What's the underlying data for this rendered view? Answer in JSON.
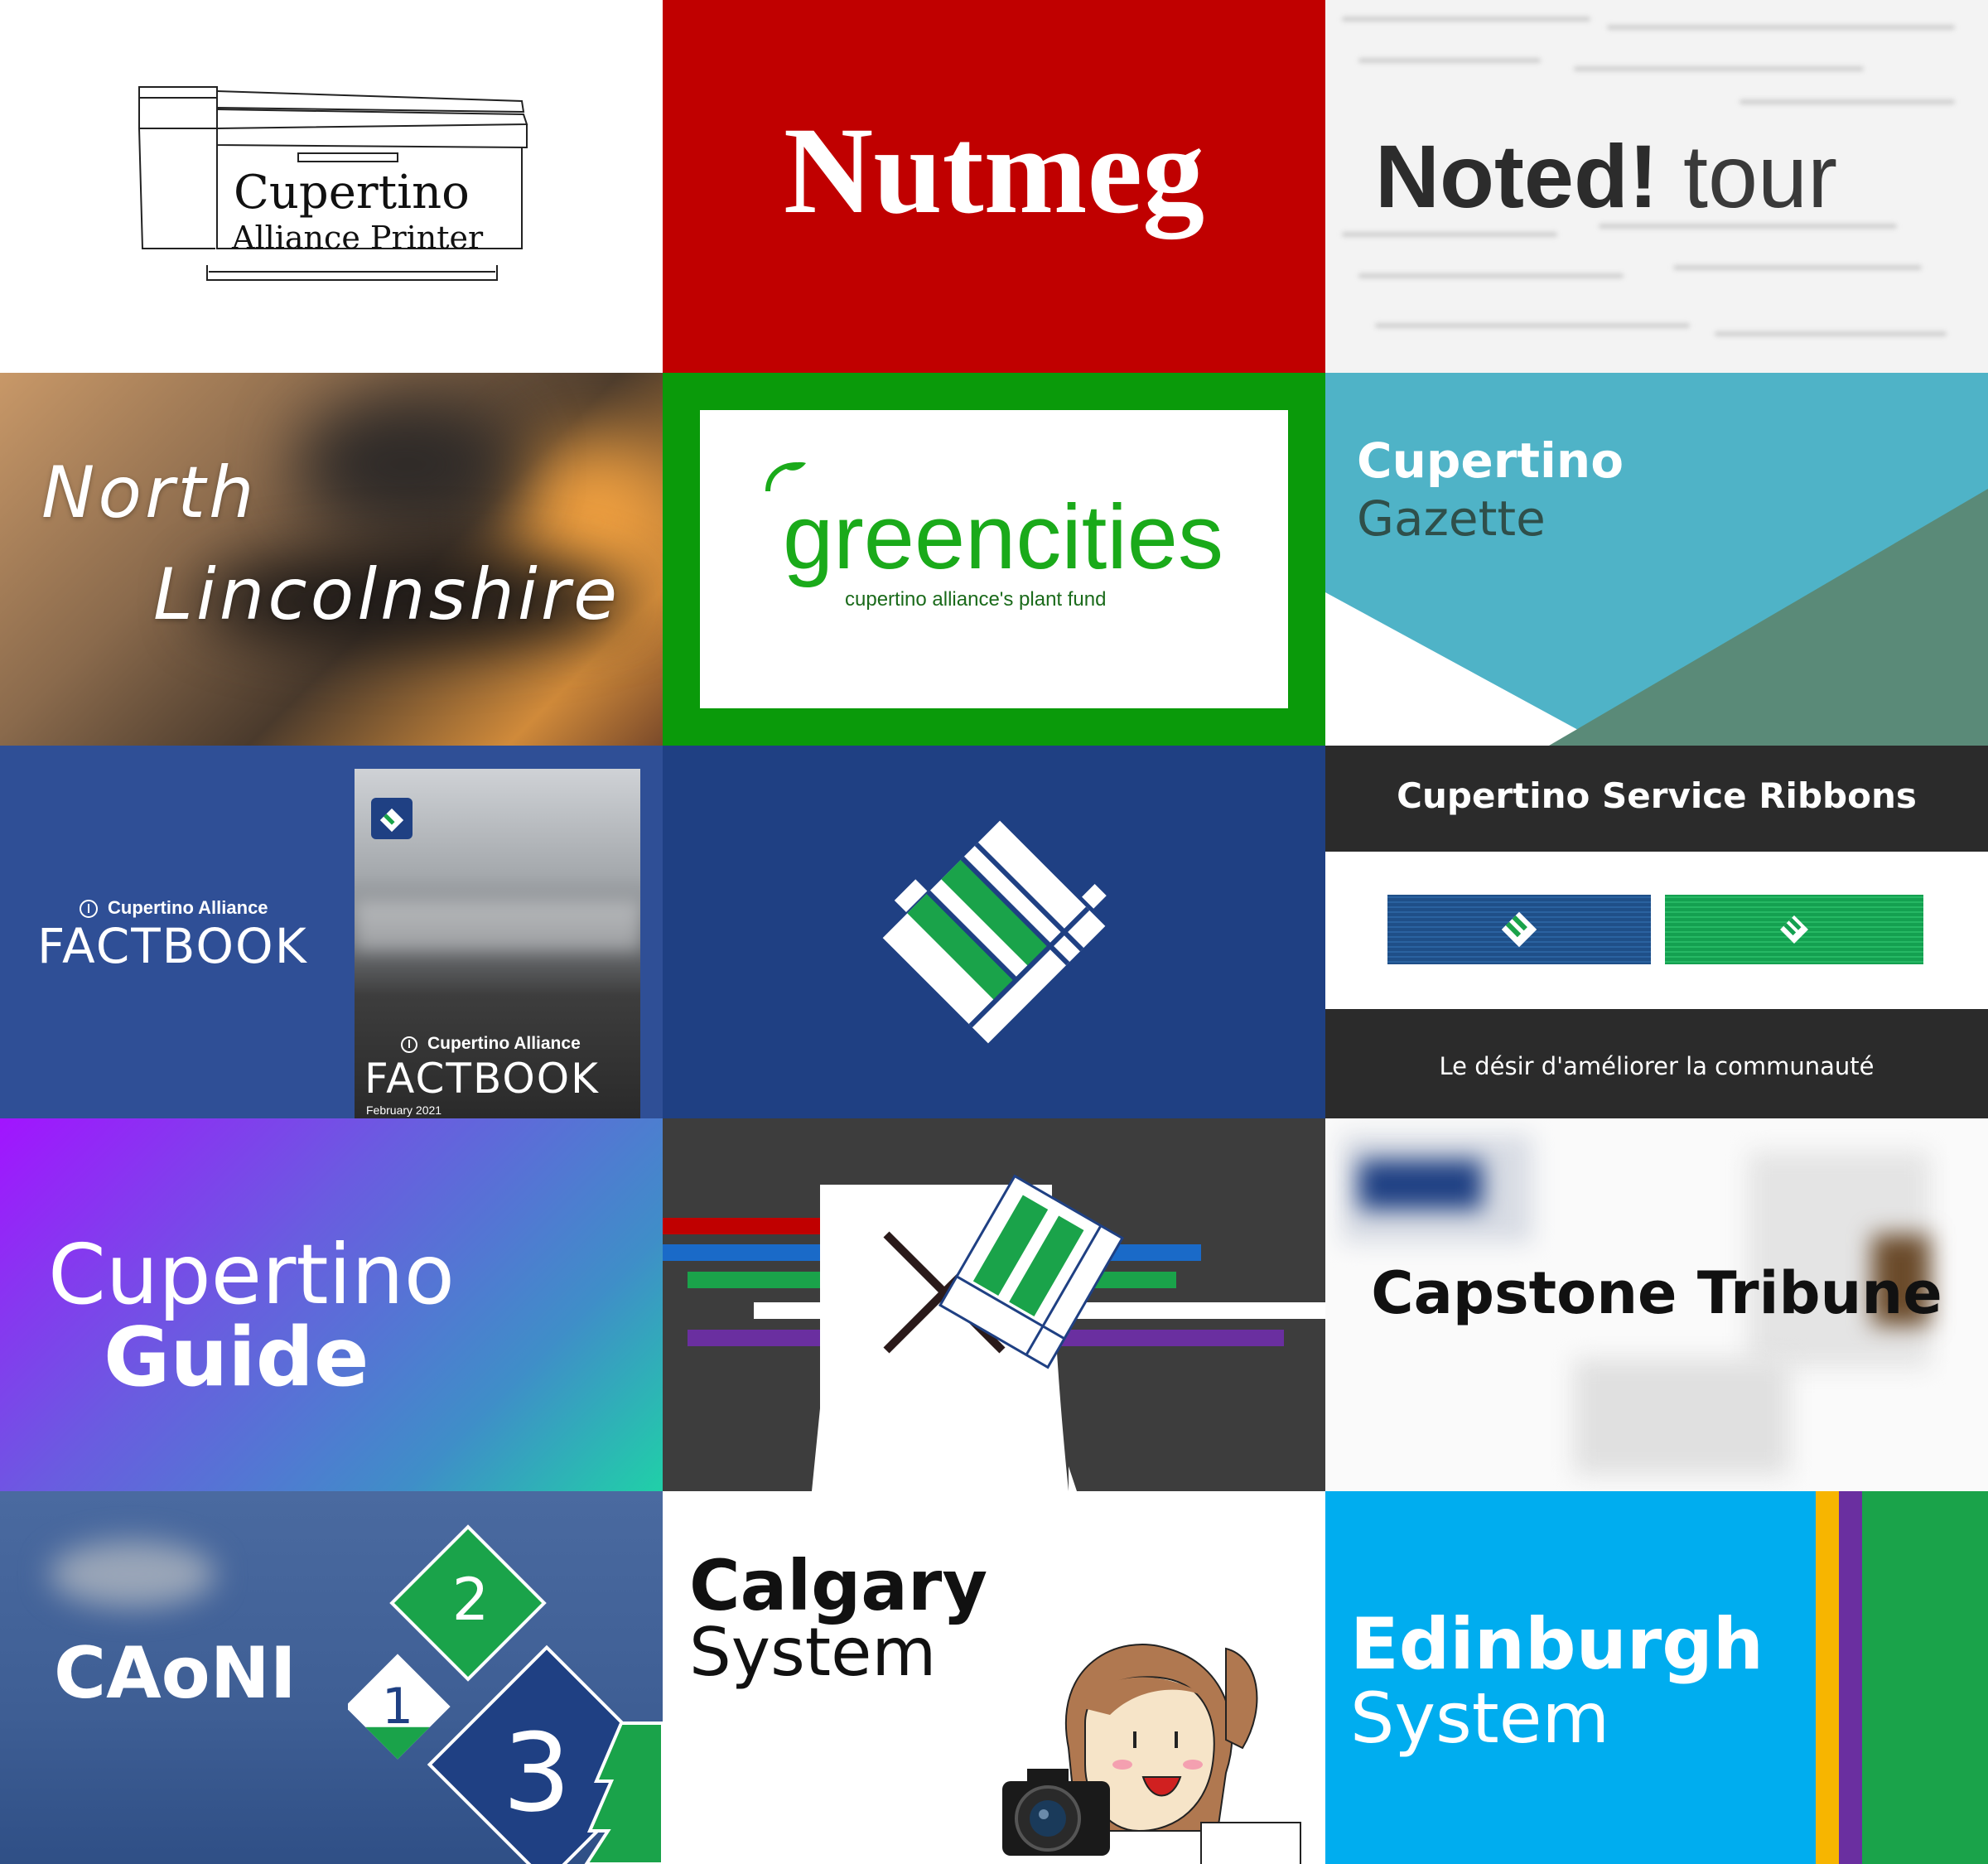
{
  "tiles": {
    "printer": {
      "line1": "Cupertino",
      "line2": "Alliance Printer"
    },
    "nutmeg": {
      "title": "Nutmeg",
      "bg": "#c00000"
    },
    "noted": {
      "bold": "Noted!",
      "light": "tour"
    },
    "north": {
      "line1": "North",
      "line2": "Lincolnshire"
    },
    "greencities": {
      "word": "greencities",
      "sub": "cupertino alliance's plant fund",
      "accent": "#0a9a0a"
    },
    "gazette": {
      "line1": "Cupertino",
      "line2": "Gazette"
    },
    "factbook": {
      "org": "Cupertino Alliance",
      "title": "FACTBOOK",
      "cover_org": "Cupertino Alliance",
      "cover_title": "FACTBOOK",
      "cover_date": "February 2021"
    },
    "ribbons": {
      "title": "Cupertino Service Ribbons",
      "motto": "Le désir d'améliorer la communauté"
    },
    "guide": {
      "line1": "Cupertino",
      "line2": "Guide"
    },
    "capstone": {
      "title": "Capstone Tribune"
    },
    "caoni": {
      "title": "CAoNI",
      "num1": "1",
      "num2": "2",
      "num3": "3"
    },
    "calgary": {
      "line1": "Calgary",
      "line2": "System"
    },
    "edinburgh": {
      "line1": "Edinburgh",
      "line2": "System"
    }
  },
  "colors": {
    "alliance_blue": "#1f4083",
    "alliance_green": "#1aa34a",
    "gazette_teal": "#4fb3c7",
    "gazette_dark": "#5a8a78",
    "edinburgh_blue": "#00adef"
  }
}
